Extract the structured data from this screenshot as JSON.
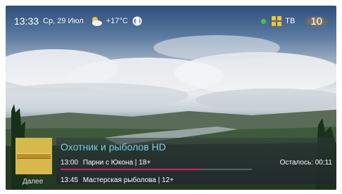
{
  "status_bar": {
    "time": "13:33",
    "date": "Ср, 29 Июл",
    "weather_icon": "partly-cloudy-icon",
    "temperature": "+17°C",
    "globe_icon": "globe-icon",
    "status_dot_color": "#4fc04a",
    "grid_icon": "grid-icon",
    "source": "ТВ",
    "channel_number": "10"
  },
  "info_panel": {
    "channel_name": "Охотник и рыболов HD",
    "now": {
      "time": "13:00",
      "title": "Парни с Юкона | 18+"
    },
    "remaining": "Осталось: 00:11",
    "progress": 0.73,
    "progress_color": "#d92366",
    "next_label": "Далее",
    "next": {
      "time": "13:45",
      "title": "Мастерская рыболова | 12+"
    }
  }
}
